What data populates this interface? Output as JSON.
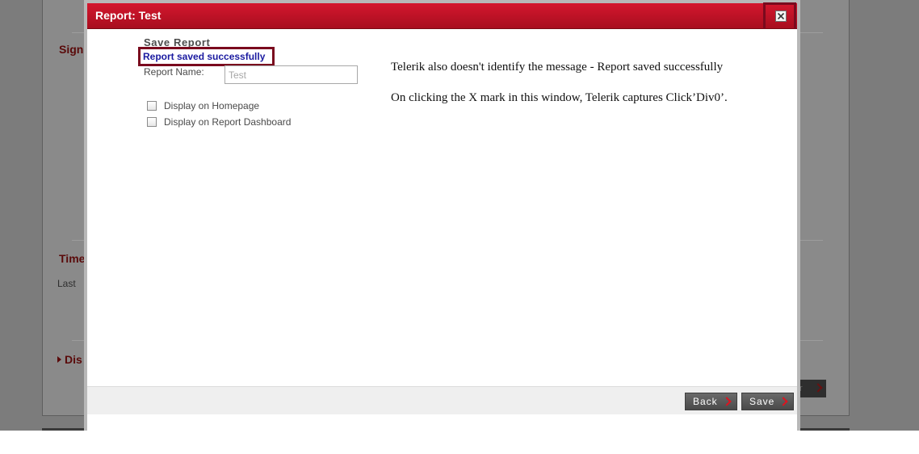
{
  "background": {
    "headings": [
      "Sign",
      "Time",
      "Dis"
    ],
    "text": "Last",
    "button_fragment": "r"
  },
  "modal": {
    "title": "Report: Test",
    "close_icon": "close-icon",
    "save_heading": "Save Report",
    "success_message": "Report saved successfully",
    "report_name_label": "Report Name:",
    "report_name_value": "Test",
    "checkboxes": [
      {
        "label": "Display on Homepage",
        "checked": false
      },
      {
        "label": "Display on Report Dashboard",
        "checked": false
      }
    ],
    "notes": [
      "Telerik also doesn't identify the message - Report saved successfully",
      "On clicking the X mark in this window, Telerik captures Click’Div0’."
    ],
    "buttons": {
      "back": "Back",
      "save": "Save"
    }
  },
  "colors": {
    "title_bar": "#c4122a",
    "highlight_box": "#7a0a1e",
    "success_text": "#1a1aa0",
    "button_chevron": "#e0131f"
  }
}
